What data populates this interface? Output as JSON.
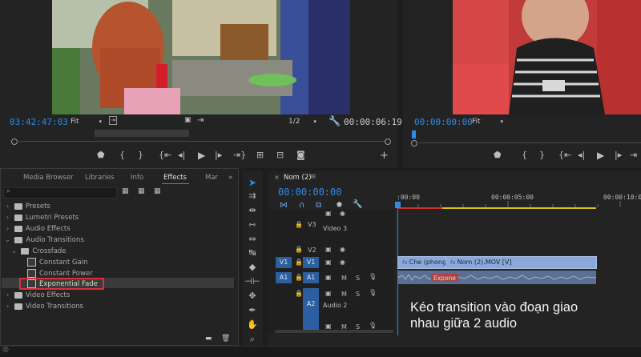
{
  "source_monitor": {
    "timecode": "03:42:47:03",
    "fit": "Fit",
    "resolution": "1/2",
    "duration": "00:00:06:19"
  },
  "program_monitor": {
    "timecode": "00:00:00:00",
    "fit": "Fit"
  },
  "effects_panel": {
    "tabs": [
      "Media Browser",
      "Libraries",
      "Info",
      "Effects",
      "Mar"
    ],
    "active_tab": "Effects",
    "search_placeholder": "",
    "tree": {
      "presets": "Presets",
      "lumetri_presets": "Lumetri Presets",
      "audio_effects": "Audio Effects",
      "audio_transitions": "Audio Transitions",
      "crossfade": "Crossfade",
      "constant_gain": "Constant Gain",
      "constant_power": "Constant Power",
      "exponential_fade": "Exponential Fade",
      "video_effects": "Video Effects",
      "video_transitions": "Video Transitions"
    },
    "highlight_color": "#d9303b"
  },
  "timeline": {
    "sequence_tab": "Nom (2)",
    "timecode": "00:00:00:00",
    "ruler": {
      "start": ":00:00",
      "mid": "00:00:05:00",
      "end": "00:00:10:00"
    },
    "tracks": {
      "v3": "V3",
      "v3_name": "Video 3",
      "v2": "V2",
      "v1_source": "V1",
      "v1": "V1",
      "a1_source": "A1",
      "a1": "A1",
      "a2": "A2",
      "a2_name": "Audio 2",
      "mute": "M",
      "solo": "S"
    },
    "clips": {
      "video1": "Che (phong",
      "video2": "Nom (2).MOV [V]",
      "transition_label": "Expone"
    },
    "playhead_color": "#2d8ceb"
  },
  "caption": {
    "line1": "Kéo transition vào đoạn giao",
    "line2": "nhau giữa 2 audio"
  }
}
